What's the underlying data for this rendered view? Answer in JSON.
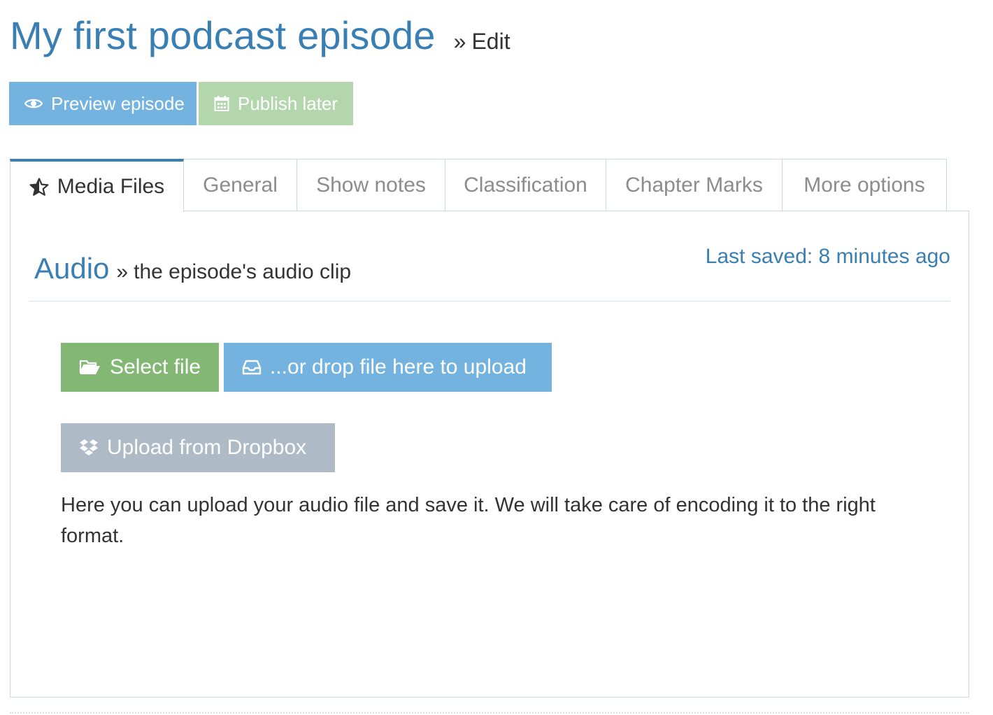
{
  "header": {
    "title": "My first podcast episode",
    "separator": "»",
    "subtitle": "Edit"
  },
  "actions": {
    "preview_label": "Preview episode",
    "preview_icon": "eye-icon",
    "publish_label": "Publish later",
    "publish_icon": "calendar-icon"
  },
  "tabs": [
    {
      "label": "Media Files",
      "icon": "star-icon",
      "active": true
    },
    {
      "label": "General",
      "active": false
    },
    {
      "label": "Show notes",
      "active": false
    },
    {
      "label": "Classification",
      "active": false
    },
    {
      "label": "Chapter Marks",
      "active": false
    },
    {
      "label": "More options",
      "active": false
    }
  ],
  "panel": {
    "section_title": "Audio",
    "section_separator": "»",
    "section_subtitle": "the episode's audio clip",
    "last_saved": "Last saved: 8 minutes ago",
    "select_file_label": "Select file",
    "select_file_icon": "folder-open-icon",
    "drop_label": "...or drop file here to upload",
    "drop_icon": "inbox-icon",
    "dropbox_label": "Upload from Dropbox",
    "dropbox_icon": "dropbox-icon",
    "help_text": "Here you can upload your audio file and save it. We will take care of encoding it to the right format."
  },
  "colors": {
    "primary": "#3a7fb3",
    "info": "#74b3df",
    "success_light": "#b4d6ad",
    "success": "#82b874",
    "muted": "#aebbc6",
    "border": "#cdd7e0"
  }
}
